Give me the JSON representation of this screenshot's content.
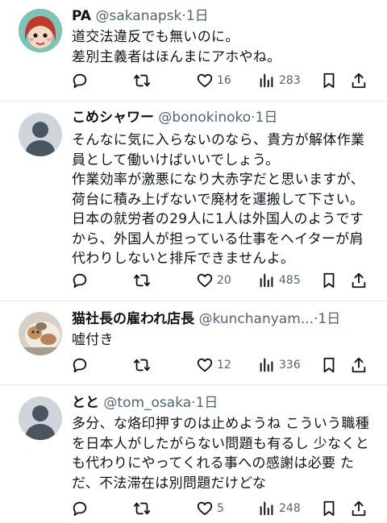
{
  "tweets": [
    {
      "name": "PA",
      "handle": "@sakanapsk",
      "time": "1日",
      "text": "道交法違反でも無いのに。\n差別主義者はほんまにアホやね。",
      "likes": "16",
      "views": "283",
      "avatar": "anime-character"
    },
    {
      "name": "こめシャワー",
      "handle": "@bonokinoko",
      "time": "1日",
      "text": "そんなに気に入らないのなら、貴方が解体作業\n員として働いけばいいでしょう。\n作業効率が激悪になり大赤字だと思いますが、\n荷台に積み上げないで廃材を運搬して下さい。\n日本の就労者の29人に1人は外国人のようです\nから、外国人が担っている仕事をヘイターが肩\n代わりしないと排斥できませんよ。",
      "likes": "20",
      "views": "485",
      "avatar": "default"
    },
    {
      "name": "猫社長の雇われ店長",
      "handle": "@kunchanyam...",
      "time": "1日",
      "text": "嘘付き",
      "likes": "12",
      "views": "336",
      "avatar": "cat-photo"
    },
    {
      "name": "とと",
      "handle": "@tom_osaka",
      "time": "1日",
      "text": "多分、な烙印押すのは止めようね こういう職種\nを日本人がしたがらない問題も有るし 少なくと\nも代わりにやってくれる事への感謝は必要 た\nだ、不法滞在は別問題だけどな",
      "likes": "5",
      "views": "248",
      "avatar": "default"
    }
  ],
  "icons": {
    "reply": "reply-icon",
    "retweet": "retweet-icon",
    "like": "heart-icon",
    "views": "views-icon",
    "bookmark": "bookmark-icon",
    "share": "share-icon"
  },
  "colors": {
    "text": "#0f1419",
    "secondary": "#536471",
    "divider": "#e6e9ec"
  }
}
